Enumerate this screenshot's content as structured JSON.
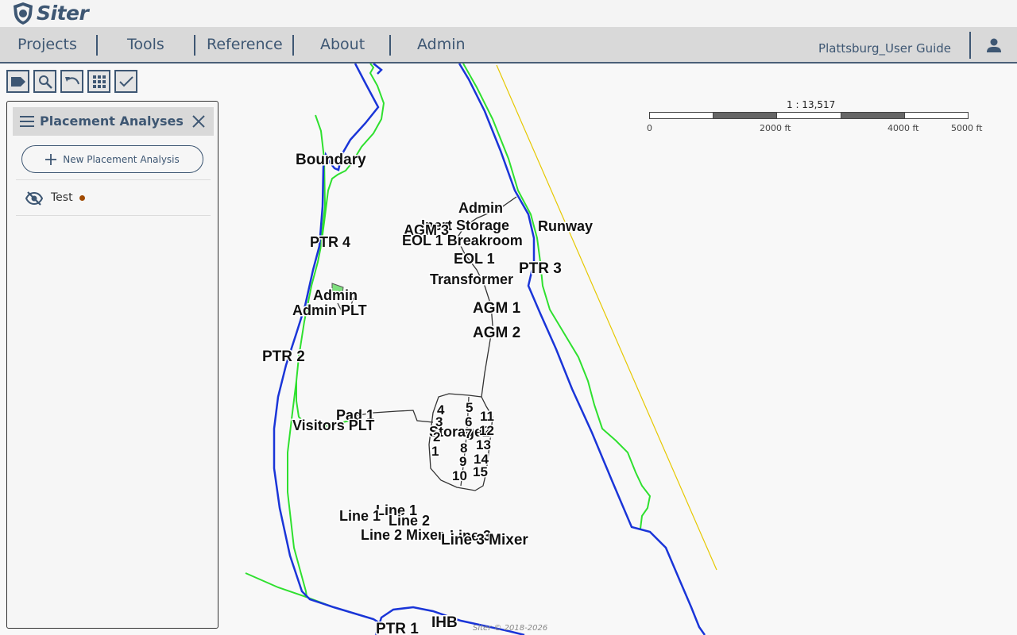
{
  "app": {
    "brand_name": "Siter",
    "project_name": "Plattsburg_User Guide"
  },
  "nav": {
    "items": [
      {
        "id": "projects",
        "label": "Projects"
      },
      {
        "id": "tools",
        "label": "Tools"
      },
      {
        "id": "reference",
        "label": "Reference"
      },
      {
        "id": "about",
        "label": "About"
      },
      {
        "id": "admin",
        "label": "Admin"
      }
    ]
  },
  "toolbar": {
    "buttons": [
      {
        "id": "label-tool",
        "icon": "label-icon"
      },
      {
        "id": "search-tool",
        "icon": "search-icon"
      },
      {
        "id": "undo-tool",
        "icon": "undo-icon"
      },
      {
        "id": "grid-tool",
        "icon": "grid-icon"
      },
      {
        "id": "check-tool",
        "icon": "check-icon"
      }
    ]
  },
  "panel": {
    "title": "Placement Analyses",
    "new_button_label": "New Placement Analysis",
    "analyses": [
      {
        "name": "Test",
        "visible": false,
        "status_color": "#a04a00"
      }
    ]
  },
  "scale": {
    "ratio": "1 : 13,517",
    "ticks": [
      "0",
      "2000 ft",
      "4000 ft",
      "5000 ft"
    ]
  },
  "map": {
    "labels": [
      {
        "text": "Boundary"
      },
      {
        "text": "Admin"
      },
      {
        "text": "Inert Storage"
      },
      {
        "text": "Runway"
      },
      {
        "text": "AGM 3"
      },
      {
        "text": "EOL 1 Breakroom"
      },
      {
        "text": "EOL 1"
      },
      {
        "text": "PTR 4"
      },
      {
        "text": "PTR 3"
      },
      {
        "text": "Transformer"
      },
      {
        "text": "Admin"
      },
      {
        "text": "Admin PLT"
      },
      {
        "text": "AGM 1"
      },
      {
        "text": "AGM 2"
      },
      {
        "text": "PTR 2"
      },
      {
        "text": "Pad 1"
      },
      {
        "text": "Visitors PLT"
      },
      {
        "text": "Storage2"
      },
      {
        "text": "Line 1"
      },
      {
        "text": "Line 1"
      },
      {
        "text": "Line 2"
      },
      {
        "text": "Line 2 Mixer"
      },
      {
        "text": "Line 3"
      },
      {
        "text": "Line 3 Mixer"
      },
      {
        "text": "PTR 1"
      },
      {
        "text": "IHB"
      }
    ],
    "magazine_numbers": [
      "4",
      "3",
      "2",
      "1",
      "5",
      "6",
      "7",
      "8",
      "9",
      "10",
      "11",
      "12",
      "13",
      "14",
      "15"
    ],
    "colors": {
      "boundary_blue": "#1a35d8",
      "boundary_green": "#2fe02f",
      "runway_yellow": "#e6c800",
      "road": "#333333",
      "accent": "#3e5773"
    }
  },
  "footer": {
    "copyright": "Siter © 2018-2026"
  }
}
